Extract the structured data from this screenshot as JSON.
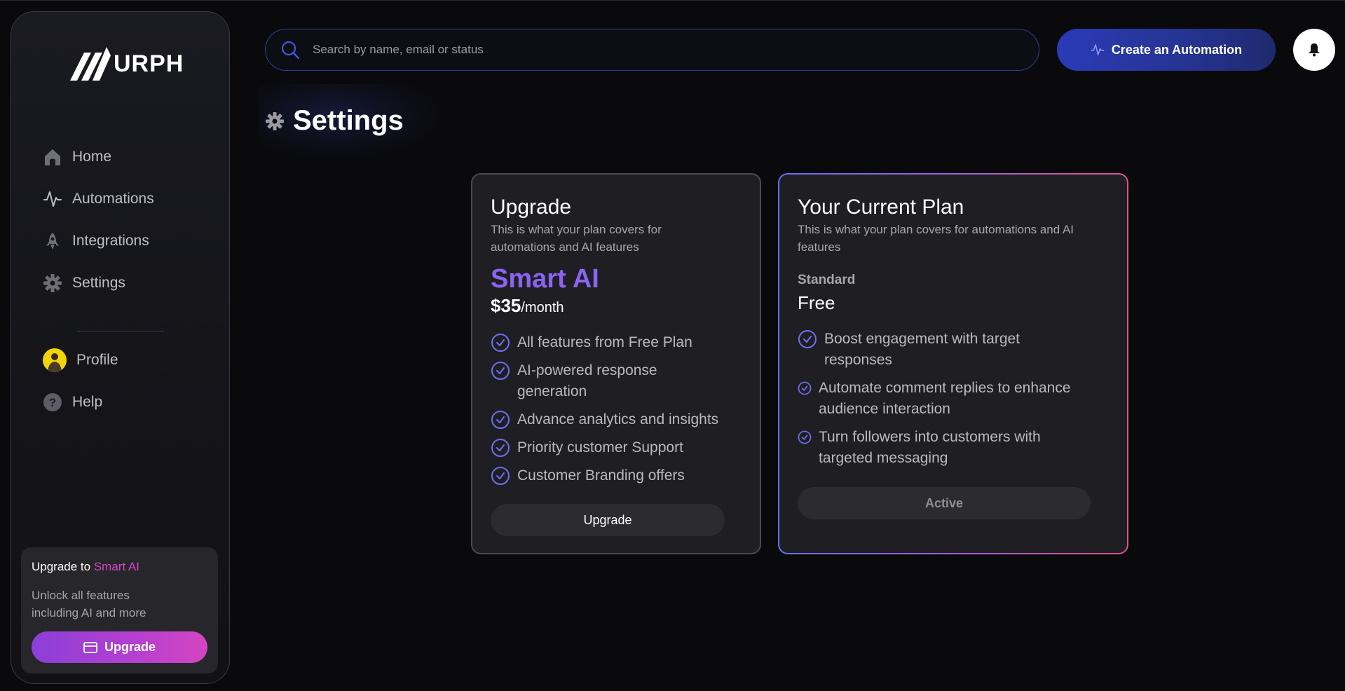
{
  "brand": {
    "name": "URPH"
  },
  "sidebar": {
    "items": [
      {
        "label": "Home",
        "icon": "home-icon"
      },
      {
        "label": "Automations",
        "icon": "activity-icon"
      },
      {
        "label": "Integrations",
        "icon": "rocket-icon"
      },
      {
        "label": "Settings",
        "icon": "gear-icon",
        "active": true
      },
      {
        "label": "Profile",
        "icon": "avatar"
      },
      {
        "label": "Help",
        "icon": "help-icon"
      }
    ],
    "upgrade": {
      "title_prefix": "Upgrade to ",
      "title_accent": "Smart AI",
      "description": "Unlock all features including AI and more",
      "button_label": "Upgrade"
    }
  },
  "header": {
    "search_placeholder": "Search by name, email or status",
    "create_label": "Create an Automation"
  },
  "page": {
    "title": "Settings"
  },
  "upgrade_card": {
    "title": "Upgrade",
    "description": "This is what your plan covers for automations and AI features",
    "plan_name": "Smart AI",
    "price": "$35",
    "period": "/month",
    "features": [
      "All features from Free Plan",
      "AI-powered response generation",
      "Advance analytics and insights",
      "Priority customer Support",
      "Customer Branding offers"
    ],
    "button_label": "Upgrade"
  },
  "current_card": {
    "title": "Your Current Plan",
    "description": "This is what your plan covers for automations and AI features",
    "tier": "Standard",
    "cost": "Free",
    "features": [
      "Boost engagement with target responses",
      "Automate comment replies to enhance audience interaction",
      "Turn followers into customers with targeted messaging"
    ],
    "status_label": "Active"
  },
  "colors": {
    "accent_purple": "#8a64f2",
    "accent_pink": "#d746c6",
    "primary_blue": "#2a3bb8",
    "check_color": "#6f6ef0"
  }
}
